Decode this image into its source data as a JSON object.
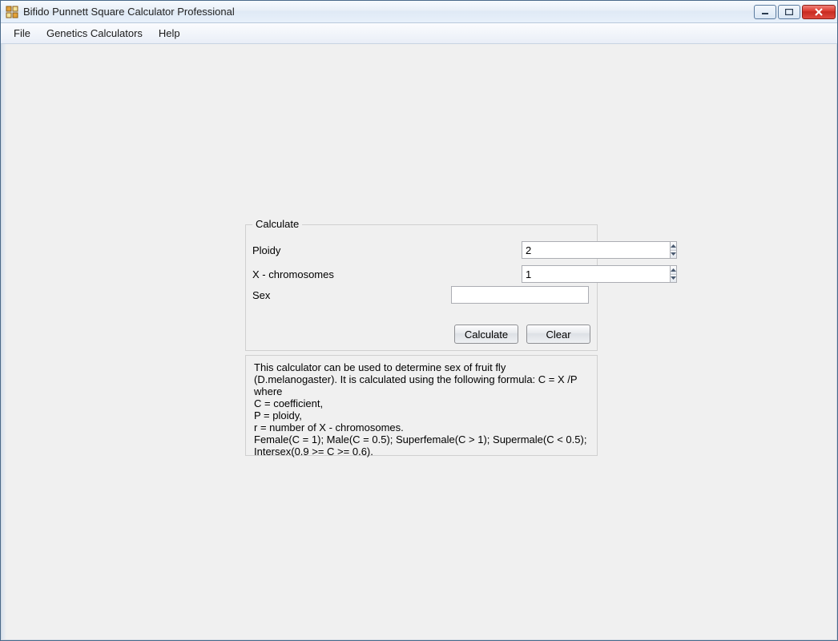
{
  "window": {
    "title": "Bifido Punnett Square Calculator Professional"
  },
  "menubar": {
    "items": [
      "File",
      "Genetics Calculators",
      "Help"
    ]
  },
  "group": {
    "legend": "Calculate",
    "ploidy_label": "Ploidy",
    "ploidy_value": "2",
    "xchrom_label": "X - chromosomes",
    "xchrom_value": "1",
    "sex_label": "Sex",
    "sex_value": ""
  },
  "buttons": {
    "calculate": "Calculate",
    "clear": "Clear"
  },
  "info_text": "This calculator can be used to determine sex of fruit fly (D.melanogaster). It is calculated using the following formula: C = X /P where\nC = coefficient,\nP = ploidy,\nr = number of X - chromosomes.\nFemale(C = 1); Male(C = 0.5); Superfemale(C > 1); Supermale(C < 0.5); Intersex(0.9 >= C >= 0.6)."
}
